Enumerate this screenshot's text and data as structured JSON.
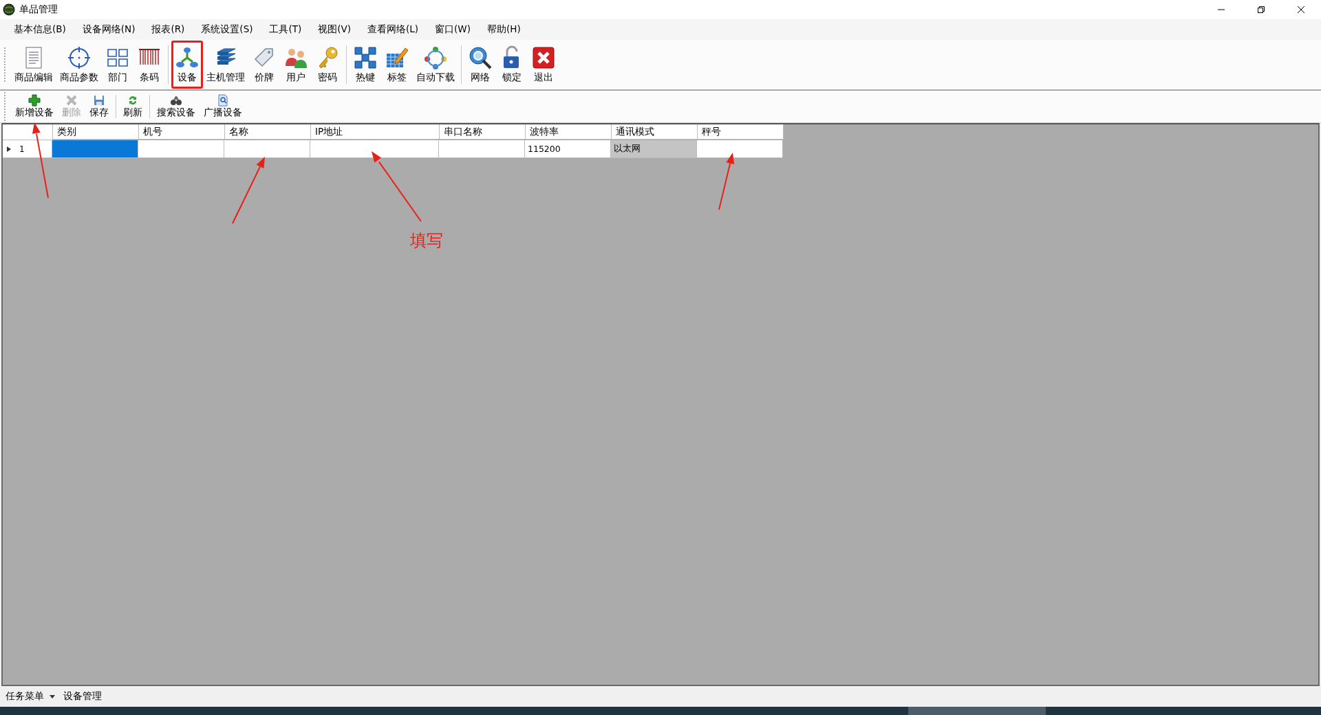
{
  "window": {
    "title": "单品管理"
  },
  "menu": [
    "基本信息(B)",
    "设备网络(N)",
    "报表(R)",
    "系统设置(S)",
    "工具(T)",
    "视图(V)",
    "查看网络(L)",
    "窗口(W)",
    "帮助(H)"
  ],
  "toolbar": {
    "groups": [
      [
        {
          "label": "商品编辑",
          "selected": false
        },
        {
          "label": "商品参数",
          "selected": false
        },
        {
          "label": "部门",
          "selected": false
        },
        {
          "label": "条码",
          "selected": false
        }
      ],
      [
        {
          "label": "设备",
          "selected": true
        },
        {
          "label": "主机管理",
          "selected": false
        },
        {
          "label": "价牌",
          "selected": false
        },
        {
          "label": "用户",
          "selected": false
        },
        {
          "label": "密码",
          "selected": false
        }
      ],
      [
        {
          "label": "热键",
          "selected": false
        },
        {
          "label": "标签",
          "selected": false
        },
        {
          "label": "自动下载",
          "selected": false
        }
      ],
      [
        {
          "label": "网络",
          "selected": false
        },
        {
          "label": "锁定",
          "selected": false
        },
        {
          "label": "退出",
          "selected": false
        }
      ]
    ]
  },
  "sub_toolbar": {
    "groups": [
      [
        {
          "label": "新增设备",
          "disabled": false
        },
        {
          "label": "删除",
          "disabled": true
        },
        {
          "label": "保存",
          "disabled": false
        }
      ],
      [
        {
          "label": "刷新",
          "disabled": false
        }
      ],
      [
        {
          "label": "搜索设备",
          "disabled": false
        },
        {
          "label": "广播设备",
          "disabled": false
        }
      ]
    ]
  },
  "table": {
    "columns": [
      "类别",
      "机号",
      "名称",
      "IP地址",
      "串口名称",
      "波特率",
      "通讯模式",
      "秤号"
    ],
    "rows": [
      {
        "row_header": "1",
        "current": true,
        "cells": [
          {
            "selected": true,
            "readonly": false
          },
          {
            "selected": false,
            "readonly": false
          },
          {
            "selected": false,
            "readonly": false
          },
          {
            "selected": false,
            "readonly": false
          },
          {
            "selected": false,
            "readonly": false
          },
          {
            "value": "115200",
            "selected": false,
            "readonly": false
          },
          {
            "value": "以太网",
            "selected": false,
            "readonly": true
          },
          {
            "selected": false,
            "readonly": false
          }
        ]
      }
    ]
  },
  "annotation": {
    "label": "填写"
  },
  "status_bar": {
    "menu": "任务菜单",
    "current": "设备管理"
  }
}
